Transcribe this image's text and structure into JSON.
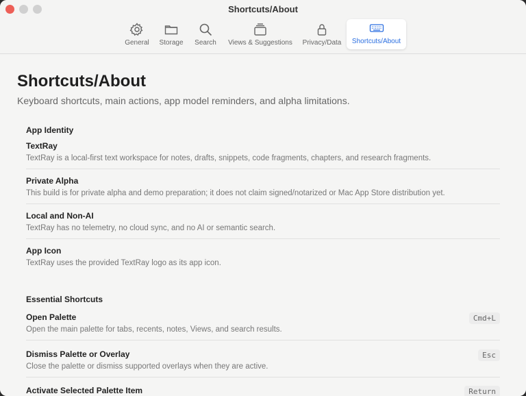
{
  "window": {
    "title": "Shortcuts/About"
  },
  "toolbar": {
    "items": [
      {
        "label": "General",
        "icon": "gear-icon"
      },
      {
        "label": "Storage",
        "icon": "folder-icon"
      },
      {
        "label": "Search",
        "icon": "magnifier-icon"
      },
      {
        "label": "Views & Suggestions",
        "icon": "stack-icon"
      },
      {
        "label": "Privacy/Data",
        "icon": "lock-icon"
      },
      {
        "label": "Shortcuts/About",
        "icon": "keyboard-icon",
        "active": true
      }
    ],
    "accent_color": "#2a6ee0"
  },
  "page": {
    "title": "Shortcuts/About",
    "subtitle": "Keyboard shortcuts, main actions, app model reminders, and alpha limitations."
  },
  "sections": [
    {
      "title": "App Identity",
      "rows": [
        {
          "title": "TextRay",
          "desc": "TextRay is a local-first text workspace for notes, drafts, snippets, code fragments, chapters, and research fragments."
        },
        {
          "title": "Private Alpha",
          "desc": "This build is for private alpha and demo preparation; it does not claim signed/notarized or Mac App Store distribution yet."
        },
        {
          "title": "Local and Non-AI",
          "desc": "TextRay has no telemetry, no cloud sync, and no AI or semantic search."
        },
        {
          "title": "App Icon",
          "desc": "TextRay uses the provided TextRay logo as its app icon."
        }
      ]
    },
    {
      "title": "Essential Shortcuts",
      "rows": [
        {
          "title": "Open Palette",
          "desc": "Open the main palette for tabs, recents, notes, Views, and search results.",
          "shortcut": "Cmd+L"
        },
        {
          "title": "Dismiss Palette or Overlay",
          "desc": "Close the palette or dismiss supported overlays when they are active.",
          "shortcut": "Esc"
        },
        {
          "title": "Activate Selected Palette Item",
          "desc": "",
          "shortcut": "Return"
        }
      ]
    }
  ]
}
